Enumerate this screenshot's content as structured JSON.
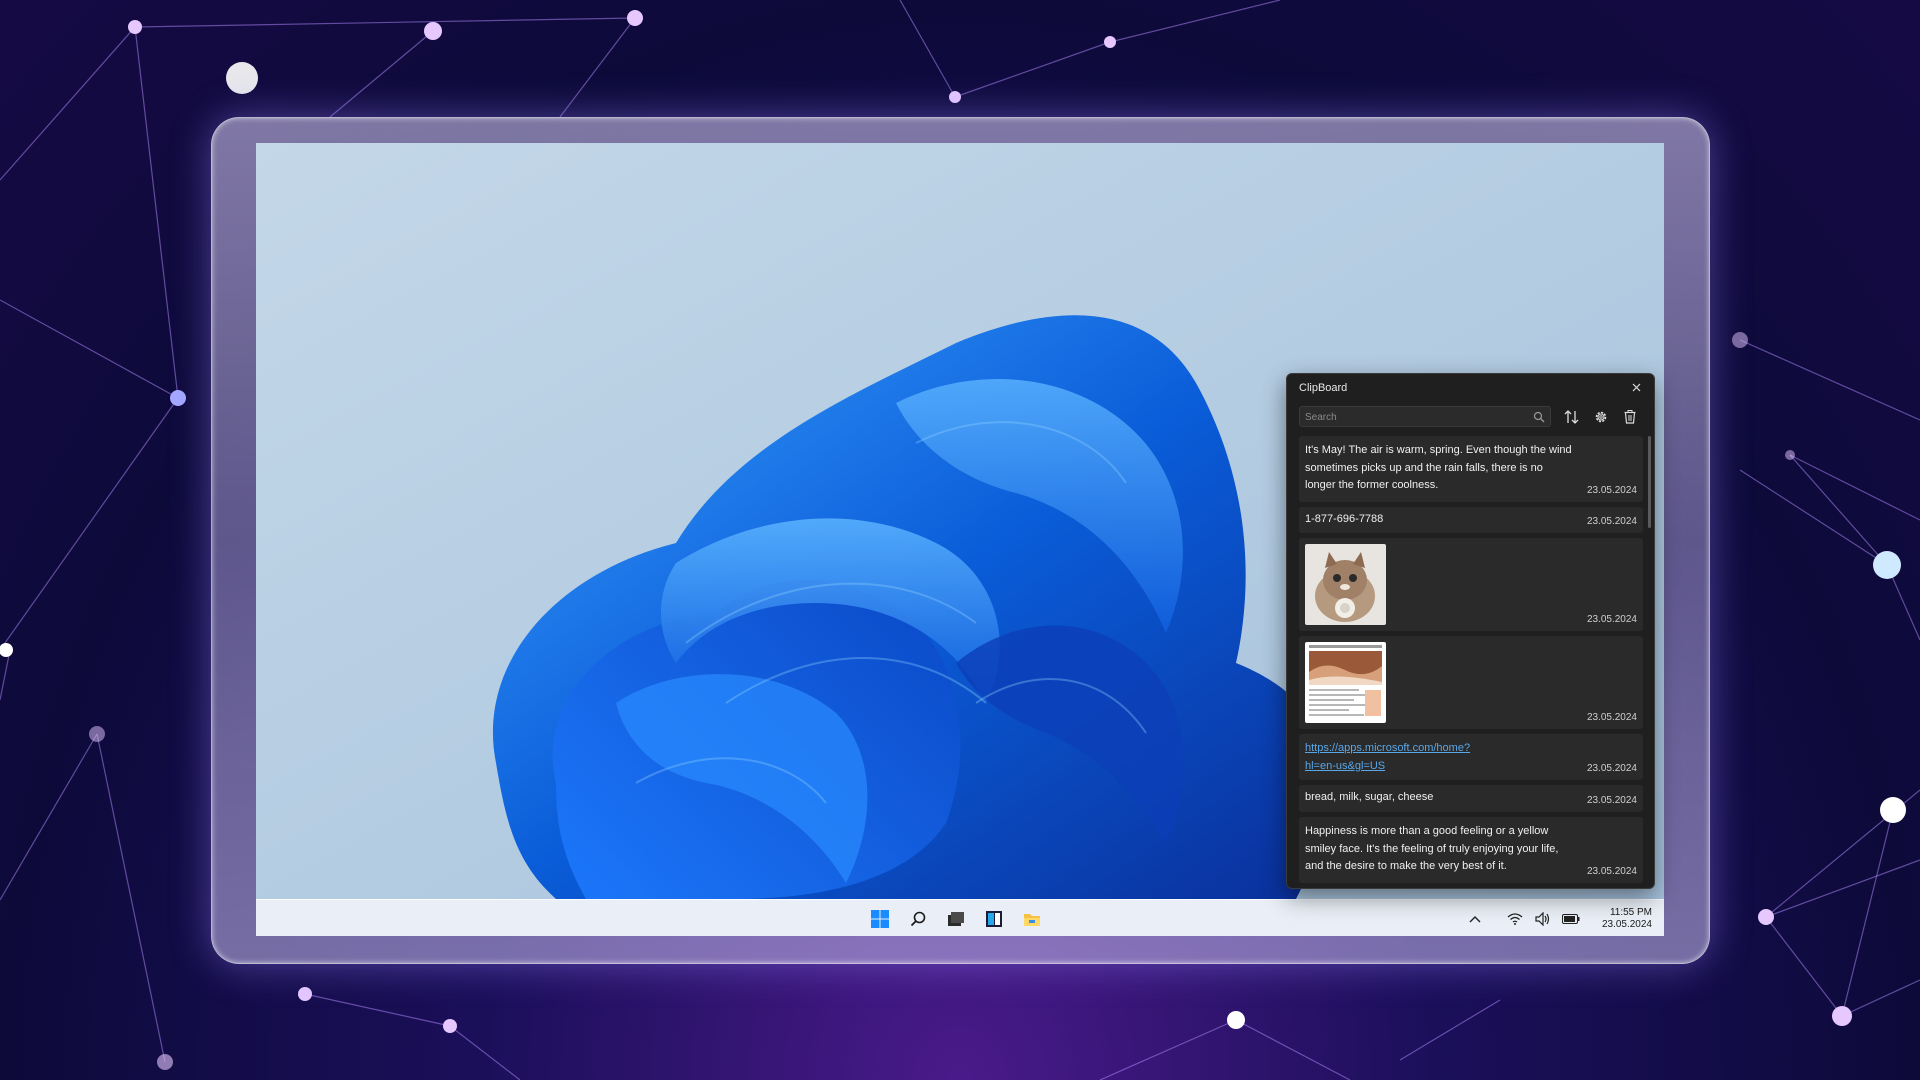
{
  "clipboard": {
    "title": "ClipBoard",
    "search_placeholder": "Search",
    "items": [
      {
        "type": "text",
        "text": "It's May! The air is warm, spring. Even though the wind sometimes picks up and the rain falls, there is no longer the former coolness.",
        "date": "23.05.2024"
      },
      {
        "type": "text",
        "text": "1-877-696-7788",
        "date": "23.05.2024"
      },
      {
        "type": "image",
        "image": "kitten photo",
        "date": "23.05.2024"
      },
      {
        "type": "image",
        "image": "document screenshot",
        "date": "23.05.2024"
      },
      {
        "type": "link",
        "text": "https://apps.microsoft.com/home?hl=en-us&gl=US",
        "line1": "https://apps.microsoft.com/home?",
        "line2": "hl=en-us&gl=US",
        "date": "23.05.2024"
      },
      {
        "type": "text",
        "text": "bread, milk, sugar, cheese",
        "date": "23.05.2024"
      },
      {
        "type": "text",
        "text": "Happiness is more than a good feeling or a yellow smiley face. It's the feeling of truly enjoying your life, and the desire to make the very best of it.",
        "date": "23.05.2024"
      }
    ]
  },
  "taskbar": {
    "apps": [
      "windows-start-icon",
      "search-icon",
      "task-view-icon",
      "store-icon",
      "file-explorer-icon"
    ],
    "tray": [
      "chevron-up-icon",
      "wifi-icon",
      "volume-icon",
      "battery-icon"
    ],
    "time": "11:55 PM",
    "date": "23.05.2024"
  },
  "colors": {
    "accent": "#0a5cd8",
    "panel_bg": "#1f1f1f",
    "item_bg": "#2a2a2a",
    "link": "#5aa7e8"
  }
}
